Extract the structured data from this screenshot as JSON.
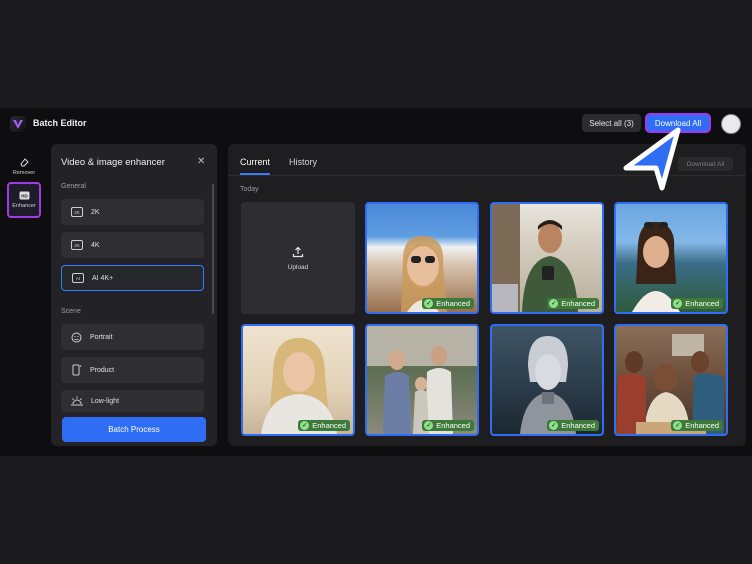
{
  "app": {
    "title": "Batch Editor"
  },
  "topbar": {
    "select_all": "Select all (3)",
    "download_all": "Download All"
  },
  "sidebar": {
    "items": [
      {
        "label": "Remover",
        "icon": "eraser-icon"
      },
      {
        "label": "Enhancer",
        "icon": "hd-icon"
      }
    ]
  },
  "panel": {
    "title": "Video & image enhancer",
    "general_label": "General",
    "general_options": [
      {
        "label": "2K",
        "icon": "2k-icon"
      },
      {
        "label": "4K",
        "icon": "4k-icon"
      },
      {
        "label": "AI 4K+",
        "icon": "ai-4k-icon"
      }
    ],
    "scene_label": "Scene",
    "scene_options": [
      {
        "label": "Portrait",
        "icon": "face-icon"
      },
      {
        "label": "Product",
        "icon": "product-icon"
      },
      {
        "label": "Low-light",
        "icon": "sun-icon"
      }
    ],
    "batch_button": "Batch Process"
  },
  "main": {
    "tabs": [
      "Current",
      "History"
    ],
    "download_all": "Download All",
    "section": "Today",
    "upload_label": "Upload",
    "badge": "Enhanced",
    "colors": {
      "accent": "#2f6df5",
      "highlight": "#9a3bea",
      "badge": "#3d7a3a"
    }
  }
}
